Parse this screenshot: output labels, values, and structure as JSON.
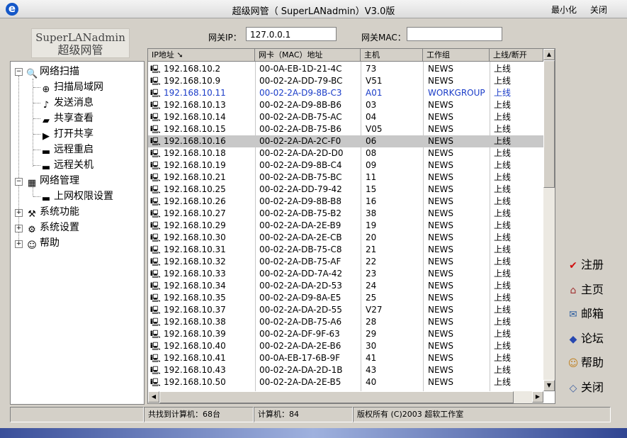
{
  "window": {
    "title": "超级网管（ SuperLANadmin）V3.0版",
    "minimize_label": "最小化",
    "close_label": "关闭"
  },
  "logo": {
    "line1": "SuperLANadmin",
    "line2": "超级网管"
  },
  "gateway": {
    "ip_label": "网关IP：",
    "ip_value": "127.0.0.1",
    "mac_label": "网关MAC：",
    "mac_value": ""
  },
  "tree": {
    "items": [
      {
        "label": "网络扫描"
      },
      {
        "label": "扫描局域网"
      },
      {
        "label": "发送消息"
      },
      {
        "label": "共享查看"
      },
      {
        "label": "打开共享"
      },
      {
        "label": "远程重启"
      },
      {
        "label": "远程关机"
      },
      {
        "label": "网络管理"
      },
      {
        "label": "上网权限设置"
      },
      {
        "label": "系统功能"
      },
      {
        "label": "系统设置"
      },
      {
        "label": "帮助"
      }
    ]
  },
  "table": {
    "headers": [
      "IP地址",
      "网卡（MAC）地址",
      "主机",
      "工作组",
      "上线/断开"
    ],
    "rows": [
      [
        "192.168.10.2",
        "00-0A-EB-1D-21-4C",
        "73",
        "NEWS",
        "上线"
      ],
      [
        "192.168.10.9",
        "00-02-2A-DD-79-BC",
        "V51",
        "NEWS",
        "上线"
      ],
      [
        "192.168.10.11",
        "00-02-2A-D9-8B-C3",
        "A01",
        "WORKGROUP",
        "上线"
      ],
      [
        "192.168.10.13",
        "00-02-2A-D9-8B-B6",
        "03",
        "NEWS",
        "上线"
      ],
      [
        "192.168.10.14",
        "00-02-2A-DB-75-AC",
        "04",
        "NEWS",
        "上线"
      ],
      [
        "192.168.10.15",
        "00-02-2A-DB-75-B6",
        "V05",
        "NEWS",
        "上线"
      ],
      [
        "192.168.10.16",
        "00-02-2A-DA-2C-F0",
        "06",
        "NEWS",
        "上线"
      ],
      [
        "192.168.10.18",
        "00-02-2A-DA-2D-D0",
        "08",
        "NEWS",
        "上线"
      ],
      [
        "192.168.10.19",
        "00-02-2A-D9-8B-C4",
        "09",
        "NEWS",
        "上线"
      ],
      [
        "192.168.10.21",
        "00-02-2A-DB-75-BC",
        "11",
        "NEWS",
        "上线"
      ],
      [
        "192.168.10.25",
        "00-02-2A-DD-79-42",
        "15",
        "NEWS",
        "上线"
      ],
      [
        "192.168.10.26",
        "00-02-2A-D9-8B-B8",
        "16",
        "NEWS",
        "上线"
      ],
      [
        "192.168.10.27",
        "00-02-2A-DB-75-B2",
        "38",
        "NEWS",
        "上线"
      ],
      [
        "192.168.10.29",
        "00-02-2A-DA-2E-B9",
        "19",
        "NEWS",
        "上线"
      ],
      [
        "192.168.10.30",
        "00-02-2A-DA-2E-CB",
        "20",
        "NEWS",
        "上线"
      ],
      [
        "192.168.10.31",
        "00-02-2A-DB-75-C8",
        "21",
        "NEWS",
        "上线"
      ],
      [
        "192.168.10.32",
        "00-02-2A-DB-75-AF",
        "22",
        "NEWS",
        "上线"
      ],
      [
        "192.168.10.33",
        "00-02-2A-DD-7A-42",
        "23",
        "NEWS",
        "上线"
      ],
      [
        "192.168.10.34",
        "00-02-2A-DA-2D-53",
        "24",
        "NEWS",
        "上线"
      ],
      [
        "192.168.10.35",
        "00-02-2A-D9-8A-E5",
        "25",
        "NEWS",
        "上线"
      ],
      [
        "192.168.10.37",
        "00-02-2A-DA-2D-55",
        "V27",
        "NEWS",
        "上线"
      ],
      [
        "192.168.10.38",
        "00-02-2A-DB-75-A6",
        "28",
        "NEWS",
        "上线"
      ],
      [
        "192.168.10.39",
        "00-02-2A-DF-9F-63",
        "29",
        "NEWS",
        "上线"
      ],
      [
        "192.168.10.40",
        "00-02-2A-DA-2E-B6",
        "30",
        "NEWS",
        "上线"
      ],
      [
        "192.168.10.41",
        "00-0A-EB-17-6B-9F",
        "41",
        "NEWS",
        "上线"
      ],
      [
        "192.168.10.43",
        "00-02-2A-DA-2D-1B",
        "43",
        "NEWS",
        "上线"
      ],
      [
        "192.168.10.50",
        "00-02-2A-DA-2E-B5",
        "40",
        "NEWS",
        "上线"
      ]
    ],
    "selected_row": 6
  },
  "side_menu": [
    {
      "label": "注册",
      "icon": "check-icon"
    },
    {
      "label": "主页",
      "icon": "home-icon"
    },
    {
      "label": "邮箱",
      "icon": "mailbox-icon"
    },
    {
      "label": "论坛",
      "icon": "forum-icon"
    },
    {
      "label": "帮助",
      "icon": "help-icon"
    },
    {
      "label": "关闭",
      "icon": "close-icon"
    }
  ],
  "status": {
    "found": "共找到计算机：68台",
    "computer": "计算机：84",
    "copyright": "版权所有 (C)2003    超软工作室"
  },
  "colors": {
    "workgroup_text": "#1a3cc8",
    "selected_row": "#c8c8c8",
    "accent_check": "#d01010"
  }
}
